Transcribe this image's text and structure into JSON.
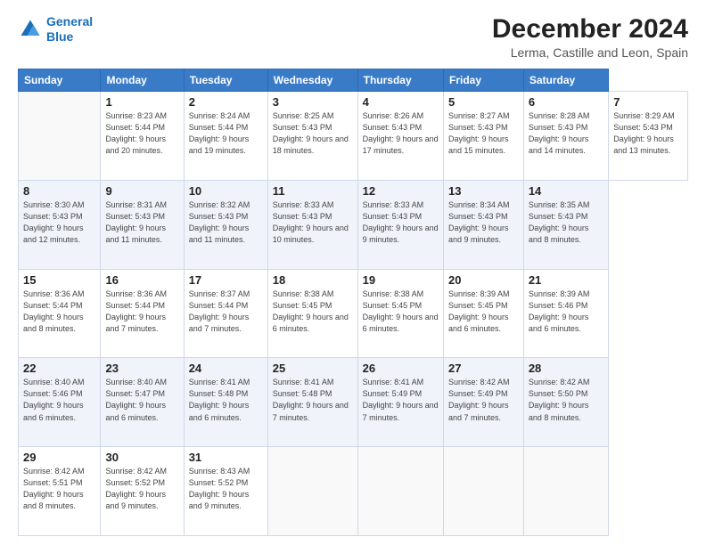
{
  "header": {
    "logo_line1": "General",
    "logo_line2": "Blue",
    "title": "December 2024",
    "subtitle": "Lerma, Castille and Leon, Spain"
  },
  "calendar": {
    "days_of_week": [
      "Sunday",
      "Monday",
      "Tuesday",
      "Wednesday",
      "Thursday",
      "Friday",
      "Saturday"
    ],
    "weeks": [
      [
        null,
        {
          "day": "1",
          "sunrise": "8:23 AM",
          "sunset": "5:44 PM",
          "daylight": "9 hours and 20 minutes."
        },
        {
          "day": "2",
          "sunrise": "8:24 AM",
          "sunset": "5:44 PM",
          "daylight": "9 hours and 19 minutes."
        },
        {
          "day": "3",
          "sunrise": "8:25 AM",
          "sunset": "5:43 PM",
          "daylight": "9 hours and 18 minutes."
        },
        {
          "day": "4",
          "sunrise": "8:26 AM",
          "sunset": "5:43 PM",
          "daylight": "9 hours and 17 minutes."
        },
        {
          "day": "5",
          "sunrise": "8:27 AM",
          "sunset": "5:43 PM",
          "daylight": "9 hours and 15 minutes."
        },
        {
          "day": "6",
          "sunrise": "8:28 AM",
          "sunset": "5:43 PM",
          "daylight": "9 hours and 14 minutes."
        },
        {
          "day": "7",
          "sunrise": "8:29 AM",
          "sunset": "5:43 PM",
          "daylight": "9 hours and 13 minutes."
        }
      ],
      [
        {
          "day": "8",
          "sunrise": "8:30 AM",
          "sunset": "5:43 PM",
          "daylight": "9 hours and 12 minutes."
        },
        {
          "day": "9",
          "sunrise": "8:31 AM",
          "sunset": "5:43 PM",
          "daylight": "9 hours and 11 minutes."
        },
        {
          "day": "10",
          "sunrise": "8:32 AM",
          "sunset": "5:43 PM",
          "daylight": "9 hours and 11 minutes."
        },
        {
          "day": "11",
          "sunrise": "8:33 AM",
          "sunset": "5:43 PM",
          "daylight": "9 hours and 10 minutes."
        },
        {
          "day": "12",
          "sunrise": "8:33 AM",
          "sunset": "5:43 PM",
          "daylight": "9 hours and 9 minutes."
        },
        {
          "day": "13",
          "sunrise": "8:34 AM",
          "sunset": "5:43 PM",
          "daylight": "9 hours and 9 minutes."
        },
        {
          "day": "14",
          "sunrise": "8:35 AM",
          "sunset": "5:43 PM",
          "daylight": "9 hours and 8 minutes."
        }
      ],
      [
        {
          "day": "15",
          "sunrise": "8:36 AM",
          "sunset": "5:44 PM",
          "daylight": "9 hours and 8 minutes."
        },
        {
          "day": "16",
          "sunrise": "8:36 AM",
          "sunset": "5:44 PM",
          "daylight": "9 hours and 7 minutes."
        },
        {
          "day": "17",
          "sunrise": "8:37 AM",
          "sunset": "5:44 PM",
          "daylight": "9 hours and 7 minutes."
        },
        {
          "day": "18",
          "sunrise": "8:38 AM",
          "sunset": "5:45 PM",
          "daylight": "9 hours and 6 minutes."
        },
        {
          "day": "19",
          "sunrise": "8:38 AM",
          "sunset": "5:45 PM",
          "daylight": "9 hours and 6 minutes."
        },
        {
          "day": "20",
          "sunrise": "8:39 AM",
          "sunset": "5:45 PM",
          "daylight": "9 hours and 6 minutes."
        },
        {
          "day": "21",
          "sunrise": "8:39 AM",
          "sunset": "5:46 PM",
          "daylight": "9 hours and 6 minutes."
        }
      ],
      [
        {
          "day": "22",
          "sunrise": "8:40 AM",
          "sunset": "5:46 PM",
          "daylight": "9 hours and 6 minutes."
        },
        {
          "day": "23",
          "sunrise": "8:40 AM",
          "sunset": "5:47 PM",
          "daylight": "9 hours and 6 minutes."
        },
        {
          "day": "24",
          "sunrise": "8:41 AM",
          "sunset": "5:48 PM",
          "daylight": "9 hours and 6 minutes."
        },
        {
          "day": "25",
          "sunrise": "8:41 AM",
          "sunset": "5:48 PM",
          "daylight": "9 hours and 7 minutes."
        },
        {
          "day": "26",
          "sunrise": "8:41 AM",
          "sunset": "5:49 PM",
          "daylight": "9 hours and 7 minutes."
        },
        {
          "day": "27",
          "sunrise": "8:42 AM",
          "sunset": "5:49 PM",
          "daylight": "9 hours and 7 minutes."
        },
        {
          "day": "28",
          "sunrise": "8:42 AM",
          "sunset": "5:50 PM",
          "daylight": "9 hours and 8 minutes."
        }
      ],
      [
        {
          "day": "29",
          "sunrise": "8:42 AM",
          "sunset": "5:51 PM",
          "daylight": "9 hours and 8 minutes."
        },
        {
          "day": "30",
          "sunrise": "8:42 AM",
          "sunset": "5:52 PM",
          "daylight": "9 hours and 9 minutes."
        },
        {
          "day": "31",
          "sunrise": "8:43 AM",
          "sunset": "5:52 PM",
          "daylight": "9 hours and 9 minutes."
        },
        null,
        null,
        null,
        null
      ]
    ]
  }
}
